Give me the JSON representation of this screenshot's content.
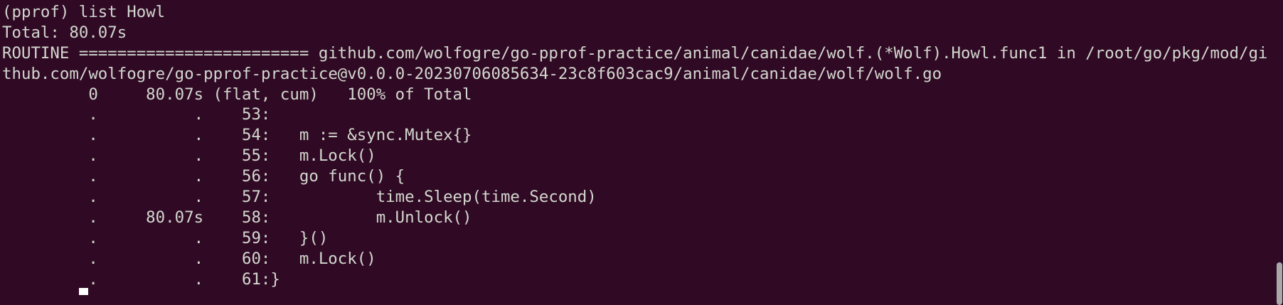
{
  "terminal": {
    "prompt_line": "(pprof) list Howl",
    "total_line": "Total: 80.07s",
    "routine_line_1": "ROUTINE ======================== github.com/wolfogre/go-pprof-practice/animal/canidae/wolf.(*Wolf).Howl.func1 in /root/go/pkg/mod/gi",
    "routine_line_2": "thub.com/wolfogre/go-pprof-practice@v0.0.0-20230706085634-23c8f603cac9/animal/canidae/wolf/wolf.go",
    "summary": {
      "flat": "0",
      "cum": "80.07s",
      "text": "(flat, cum)   100% of Total"
    },
    "rows": [
      {
        "flat": ".",
        "cum": ".",
        "line": "53:",
        "code": ""
      },
      {
        "flat": ".",
        "cum": ".",
        "line": "54:",
        "code": "   m := &sync.Mutex{}"
      },
      {
        "flat": ".",
        "cum": ".",
        "line": "55:",
        "code": "   m.Lock()"
      },
      {
        "flat": ".",
        "cum": ".",
        "line": "56:",
        "code": "   go func() {"
      },
      {
        "flat": ".",
        "cum": ".",
        "line": "57:",
        "code": "           time.Sleep(time.Second)"
      },
      {
        "flat": ".",
        "cum": "80.07s",
        "line": "58:",
        "code": "           m.Unlock()"
      },
      {
        "flat": ".",
        "cum": ".",
        "line": "59:",
        "code": "   }()"
      },
      {
        "flat": ".",
        "cum": ".",
        "line": "60:",
        "code": "   m.Lock()"
      },
      {
        "flat": ".",
        "cum": ".",
        "line": "61:",
        "code": "}"
      }
    ]
  },
  "colors": {
    "background": "#300a24",
    "text": "#d3d7cf"
  }
}
